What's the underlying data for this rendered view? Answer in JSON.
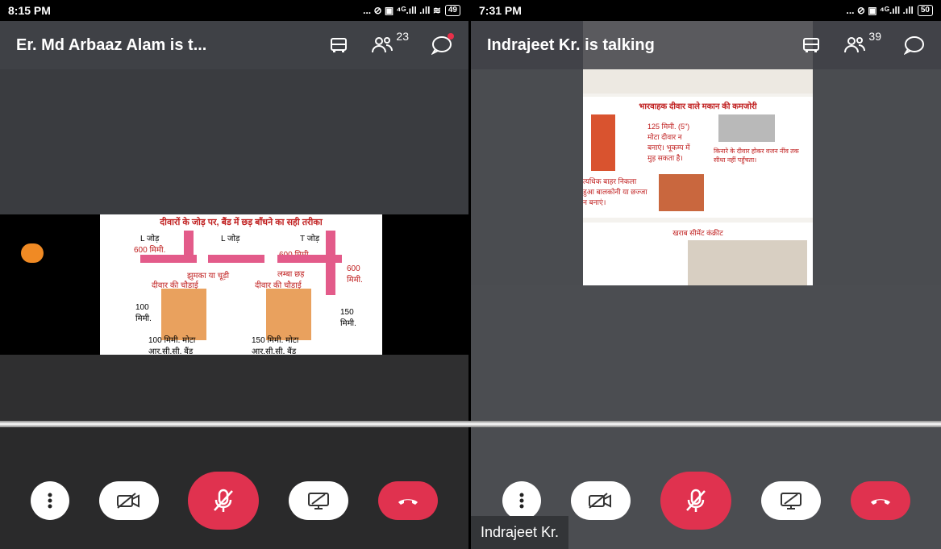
{
  "left": {
    "status_time": "8:15 PM",
    "status_icons": "... ⊘ ▣ ⁴ᴳ.ıll .ıll ≋",
    "battery": "49",
    "title": "Er. Md Arbaaz Alam is t...",
    "participants_count": "23",
    "slide": {
      "heading": "दीवारों के जोड़ पर,  बैंड में छड़ बाँधने का सही तरीका",
      "l_jod": "L जोड़",
      "t_jod": "T जोड़",
      "mm600": "600 मिमी.",
      "mm600_b": "600 मिमी.",
      "jhumka": "झुमका या चूड़ी",
      "lamba": "लम्बा छड़",
      "wall_width": "दीवार की चौड़ाई",
      "mm100": "100 मिमी.",
      "mm150": "150 मिमी.",
      "band100": "100 मिमी. मोटा आर.सी.सी. बैंड",
      "band150": "150 मिमी. मोटा आर.सी.सी. बैंड"
    }
  },
  "right": {
    "status_time": "7:31 PM",
    "status_icons": "... ⊘ ▣ ⁴ᴳ.ıll .ıll",
    "battery": "50",
    "title": "Indrajeet Kr. is talking",
    "participants_count": "39",
    "name_tag": "Indrajeet Kr.",
    "slide": {
      "heading1": "भारवाहक दीवार वाले मकान की कमजोरी",
      "note1": "125 मिमी. (5\") मोटा दीवार न बनाएं। भूकम्प में मुड़ सकता है।",
      "note2": "किनारे के दीवार होकर वजन नींव तक सीधा नहीं पहुँचता।",
      "note3": "त्यधिक बाहर निकला हुआ बालकोनी या छज्जा न बनाएं।",
      "heading2": "खराब सीमेंट कंक्रीट"
    }
  },
  "colors": {
    "accent": "#e0324f",
    "bar": "#3f4146"
  }
}
